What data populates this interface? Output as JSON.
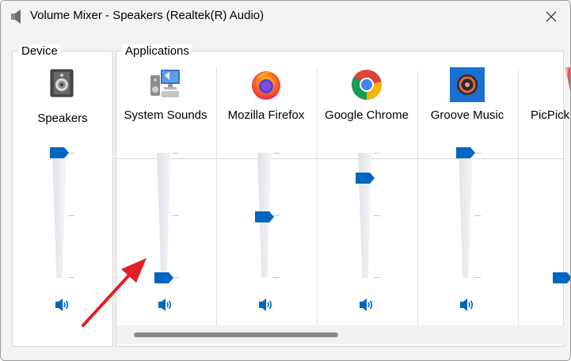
{
  "window": {
    "title": "Volume Mixer - Speakers (Realtek(R) Audio)",
    "close_glyph": "✕"
  },
  "groups": {
    "device_label": "Device",
    "applications_label": "Applications"
  },
  "device": {
    "label": "Speakers",
    "icon": "speaker-device-icon",
    "volume_percent": 100
  },
  "applications": [
    {
      "label": "System Sounds",
      "icon": "system-sounds-icon",
      "volume_percent": 0
    },
    {
      "label": "Mozilla Firefox",
      "icon": "firefox-icon",
      "volume_percent": 49
    },
    {
      "label": "Google Chrome",
      "icon": "chrome-icon",
      "volume_percent": 80
    },
    {
      "label": "Groove Music",
      "icon": "groove-music-icon",
      "volume_percent": 100
    },
    {
      "label": "PicPick",
      "icon": "picpick-icon",
      "volume_percent": 0
    }
  ],
  "colors": {
    "accent": "#0067c0",
    "arrow": "#e02028",
    "window_bg": "#f3f3f3"
  }
}
